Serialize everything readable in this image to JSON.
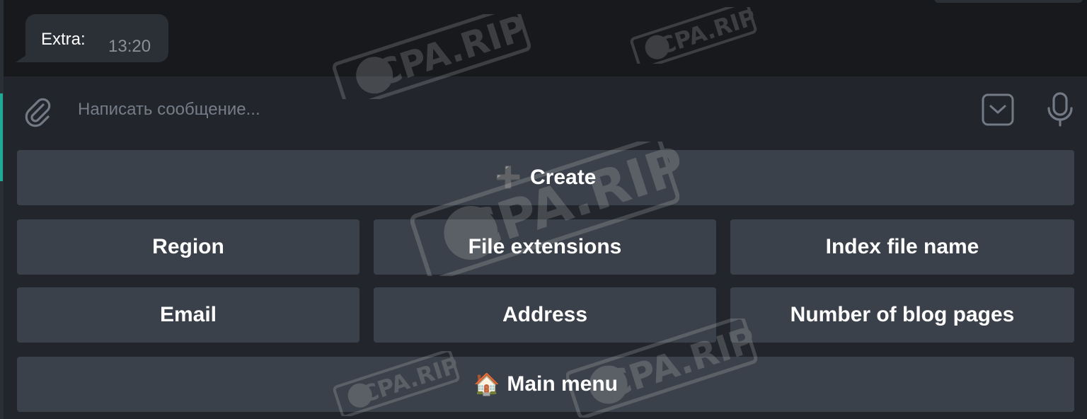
{
  "chat": {
    "message_text": "Extra:",
    "message_time": "13:20"
  },
  "composer": {
    "placeholder": "Написать сообщение...",
    "attach_icon": "paperclip-icon",
    "keyboard_icon": "keyboard-toggle-icon",
    "mic_icon": "microphone-icon"
  },
  "keyboard": {
    "create": {
      "emoji": "➕",
      "label": "Create"
    },
    "row2": [
      "Region",
      "File extensions",
      "Index file name"
    ],
    "row3": [
      "Email",
      "Address",
      "Number of blog pages"
    ],
    "main_menu": {
      "emoji": "🏠",
      "label": "Main menu"
    }
  },
  "watermark": {
    "text": "CPA.RIP"
  },
  "colors": {
    "chat_background": "#17191d",
    "panel_background": "#22262c",
    "button_background": "#3b414a",
    "bubble_background": "#2b2f36",
    "accent": "#21a995",
    "text_primary": "#ffffff",
    "text_muted": "#8a9099"
  }
}
